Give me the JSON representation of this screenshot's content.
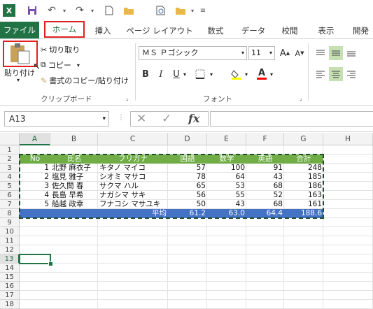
{
  "qat": {
    "excel_logo": "X",
    "icons": [
      "save-icon",
      "undo-icon",
      "redo-icon",
      "new-file-icon",
      "open-folder-icon",
      "print-preview-icon",
      "open-icon"
    ]
  },
  "tabs": {
    "file": "ファイル",
    "home": "ホーム",
    "insert": "挿入",
    "page_layout": "ページ レイアウト",
    "formulas": "数式",
    "data": "データ",
    "review": "校閲",
    "view": "表示",
    "developer": "開発"
  },
  "ribbon": {
    "paste": "貼り付け",
    "cut": "切り取り",
    "copy": "コピー",
    "format_painter": "書式のコピー/貼り付け",
    "clipboard_group": "クリップボード",
    "font_name": "ＭＳ Ｐゴシック",
    "font_size": "11",
    "grow_font": "A",
    "shrink_font": "A",
    "bold": "B",
    "italic": "I",
    "underline": "U",
    "font_color_glyph": "A",
    "font_group": "フォント"
  },
  "formula_bar": {
    "name_box": "A13",
    "fx": "fx",
    "formula": ""
  },
  "sheet": {
    "columns": [
      "A",
      "B",
      "C",
      "D",
      "E",
      "F",
      "G",
      "H"
    ],
    "rows": [
      "1",
      "2",
      "3",
      "4",
      "5",
      "6",
      "7",
      "8",
      "9",
      "10",
      "11",
      "12",
      "13",
      "14",
      "15",
      "16",
      "17",
      "18"
    ],
    "header": [
      "No",
      "氏名",
      "フリガナ",
      "国語",
      "数学",
      "英語",
      "合計"
    ],
    "data": [
      [
        "1",
        "北野 麻衣子",
        "キタノ マイコ",
        "57",
        "100",
        "91",
        "248"
      ],
      [
        "2",
        "塩見 雅子",
        "シオミ マサコ",
        "78",
        "64",
        "43",
        "185"
      ],
      [
        "3",
        "佐久間 春",
        "サクマ ハル",
        "65",
        "53",
        "68",
        "186"
      ],
      [
        "4",
        "長島 早希",
        "ナガシマ サキ",
        "56",
        "55",
        "52",
        "163"
      ],
      [
        "5",
        "船越 政幸",
        "フナコシ マサユキ",
        "50",
        "43",
        "68",
        "161"
      ]
    ],
    "avg_label": "平均",
    "avg": [
      "61.2",
      "63.0",
      "64.4",
      "188.6"
    ],
    "colors": {
      "header_bg": "#70ad47",
      "avg_bg": "#4472c4",
      "accent": "#217346",
      "highlight": "#e02020"
    }
  }
}
